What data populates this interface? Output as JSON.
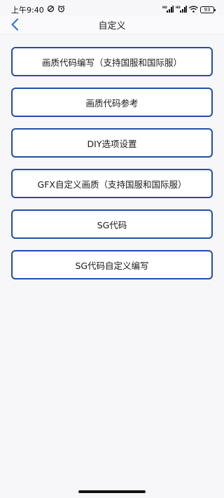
{
  "status_bar": {
    "time": "上午9:40",
    "battery": "93"
  },
  "nav": {
    "title": "自定义"
  },
  "menu": {
    "items": [
      {
        "label": "画质代码编写（支持国服和国际服）"
      },
      {
        "label": "画质代码参考"
      },
      {
        "label": "DIY选项设置"
      },
      {
        "label": "GFX自定义画质（支持国服和国际服）"
      },
      {
        "label": "SG代码"
      },
      {
        "label": "SG代码自定义编写"
      }
    ]
  },
  "colors": {
    "accent": "#1f4fa8",
    "back_arrow": "#2a6fd6",
    "background": "#f7f7f9"
  }
}
